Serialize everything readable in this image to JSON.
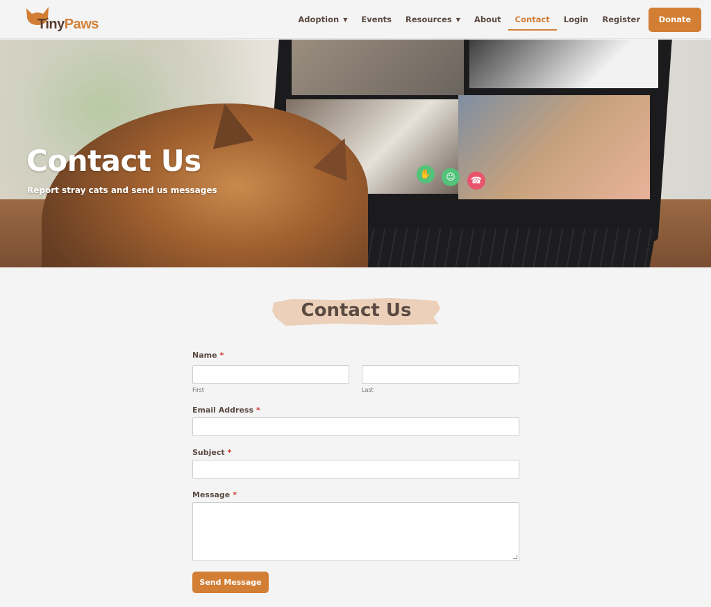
{
  "brand": {
    "name_part1": "Tiny",
    "name_part2": "Paws",
    "logo_icon": "cat-head-icon",
    "accent_color": "#d27e34"
  },
  "nav": {
    "items": [
      {
        "label": "Adoption",
        "dropdown": true
      },
      {
        "label": "Events",
        "dropdown": false
      },
      {
        "label": "Resources",
        "dropdown": true
      },
      {
        "label": "About",
        "dropdown": false
      },
      {
        "label": "Contact",
        "dropdown": false,
        "active": true
      },
      {
        "label": "Login",
        "dropdown": false
      },
      {
        "label": "Register",
        "dropdown": false
      }
    ],
    "donate_label": "Donate"
  },
  "hero": {
    "title": "Contact Us",
    "subtitle": "Report stray cats and send us messages"
  },
  "section": {
    "title": "Contact Us"
  },
  "form": {
    "name_label": "Name",
    "first_sublabel": "First",
    "last_sublabel": "Last",
    "first_value": "",
    "last_value": "",
    "email_label": "Email Address",
    "email_value": "",
    "subject_label": "Subject",
    "subject_value": "",
    "message_label": "Message",
    "message_value": "",
    "required_marker": "*",
    "submit_label": "Send Message"
  }
}
